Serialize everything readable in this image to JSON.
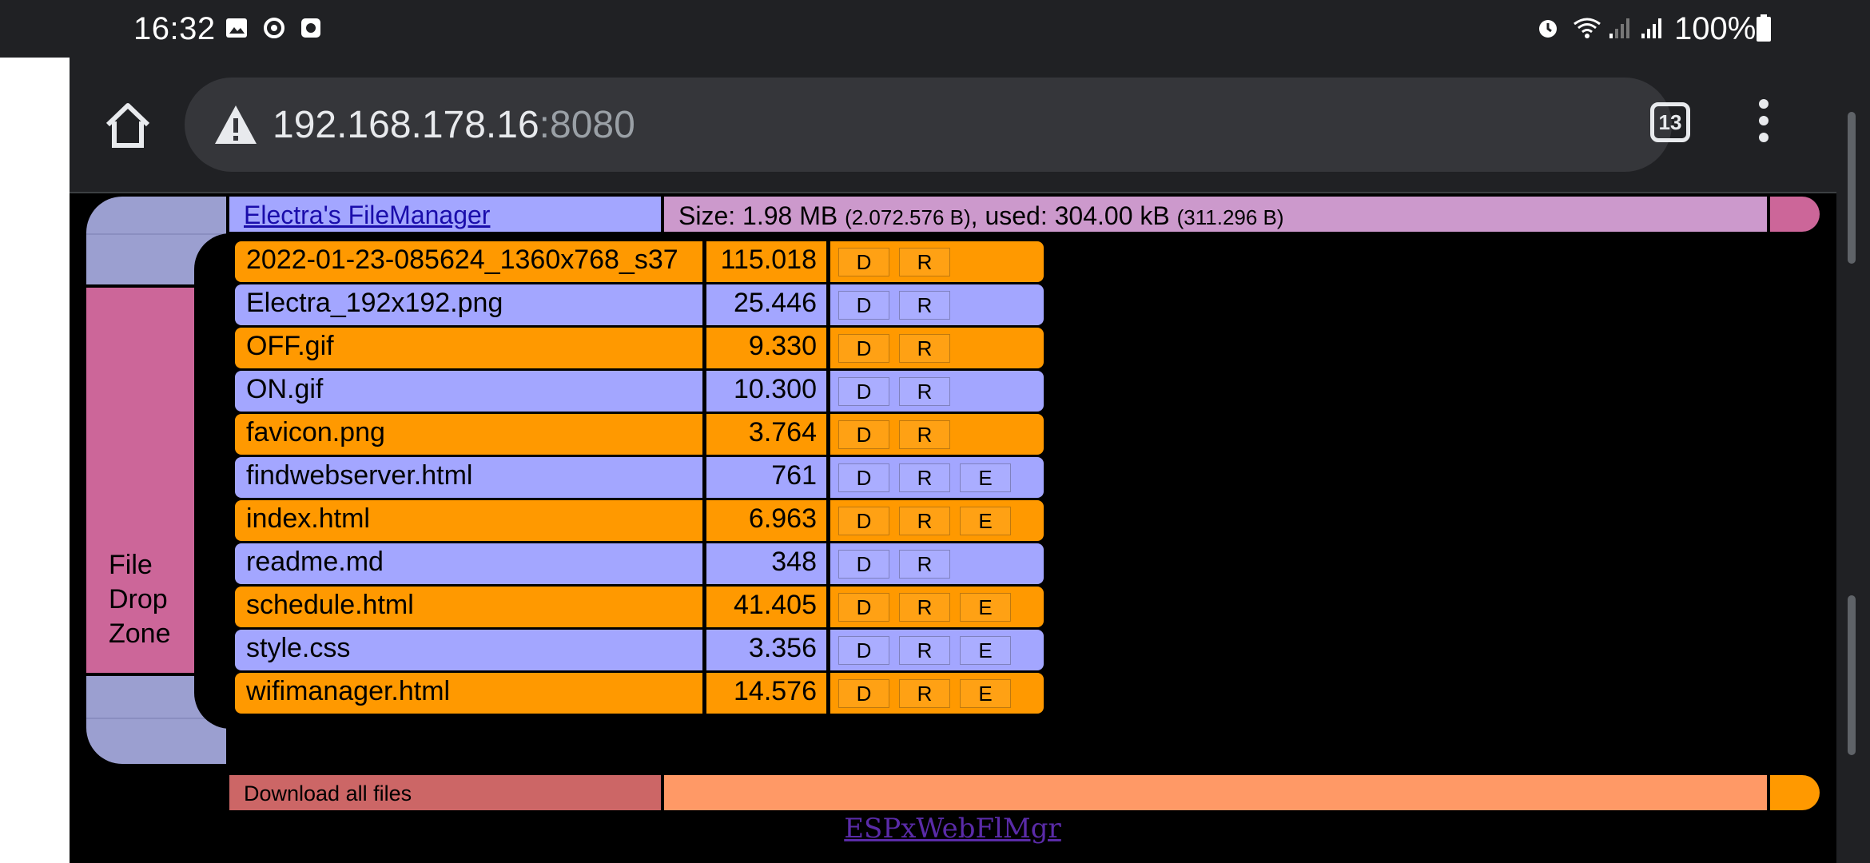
{
  "status_bar": {
    "time": "16:32",
    "left_icons": [
      "image-icon",
      "sync-icon",
      "record-icon"
    ],
    "right_icons": [
      "alarm-icon",
      "wifi-icon",
      "signal-icon",
      "signal-icon-2",
      "battery-icon"
    ],
    "battery": "100%"
  },
  "browser": {
    "url_host": "192.168.178.16",
    "url_port": ":8080",
    "tab_count": "13",
    "security_icon": "warning-icon"
  },
  "header": {
    "title": "Electra's FileManager",
    "size_prefix": "Size: 1.98 MB ",
    "size_bytes": "(2.072.576 B)",
    "used_prefix": ", used: 304.00 kB ",
    "used_bytes": "(311.296 B)"
  },
  "drop_zone": {
    "line1": "File",
    "line2": "Drop",
    "line3": "Zone"
  },
  "files": [
    {
      "name": "2022-01-23-085624_1360x768_s37",
      "size": "115.018",
      "actions": [
        "D",
        "R"
      ]
    },
    {
      "name": "Electra_192x192.png",
      "size": "25.446",
      "actions": [
        "D",
        "R"
      ]
    },
    {
      "name": "OFF.gif",
      "size": "9.330",
      "actions": [
        "D",
        "R"
      ]
    },
    {
      "name": "ON.gif",
      "size": "10.300",
      "actions": [
        "D",
        "R"
      ]
    },
    {
      "name": "favicon.png",
      "size": "3.764",
      "actions": [
        "D",
        "R"
      ]
    },
    {
      "name": "findwebserver.html",
      "size": "761",
      "actions": [
        "D",
        "R",
        "E"
      ]
    },
    {
      "name": "index.html",
      "size": "6.963",
      "actions": [
        "D",
        "R",
        "E"
      ]
    },
    {
      "name": "readme.md",
      "size": "348",
      "actions": [
        "D",
        "R"
      ]
    },
    {
      "name": "schedule.html",
      "size": "41.405",
      "actions": [
        "D",
        "R",
        "E"
      ]
    },
    {
      "name": "style.css",
      "size": "3.356",
      "actions": [
        "D",
        "R",
        "E"
      ]
    },
    {
      "name": "wifimanager.html",
      "size": "14.576",
      "actions": [
        "D",
        "R",
        "E"
      ]
    }
  ],
  "footer": {
    "download_all": "Download all files",
    "signature": "ESPxWebFlMgr"
  },
  "colors": {
    "orange": "#ff9900",
    "lavender": "#a3a6ff",
    "pink": "#cc6699",
    "mauve": "#cc99cc",
    "salmon": "#ff9966",
    "red": "#cc6666"
  }
}
